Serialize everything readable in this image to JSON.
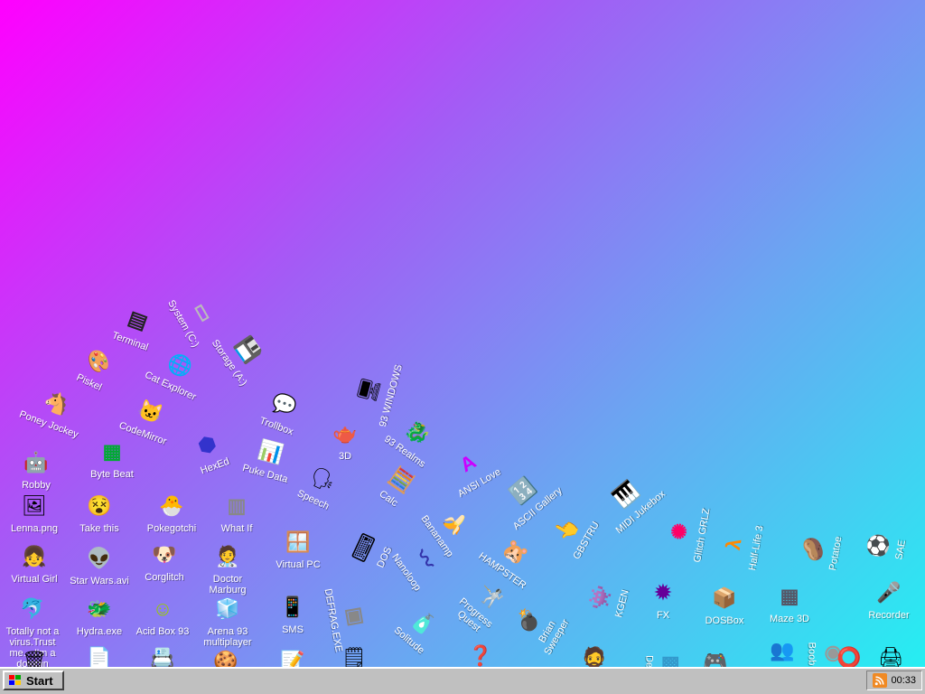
{
  "desktop": {
    "icons": [
      {
        "label": "Terminal",
        "icon": "terminal-icon",
        "glyph": "▤",
        "color": "#222"
      },
      {
        "label": "System (C:)",
        "icon": "drive-icon",
        "glyph": "▭",
        "color": "#bbb"
      },
      {
        "label": "Piskel",
        "icon": "palette-icon",
        "glyph": "🎨",
        "color": ""
      },
      {
        "label": "Cat Explorer",
        "icon": "globe-icon",
        "glyph": "🌐",
        "color": ""
      },
      {
        "label": "Storage (A:)",
        "icon": "floppy-icon",
        "glyph": "💾",
        "color": ""
      },
      {
        "label": "Poney Jockey",
        "icon": "pony-icon",
        "glyph": "🐴",
        "color": ""
      },
      {
        "label": "CodeMirror",
        "icon": "cat-icon",
        "glyph": "🐱",
        "color": ""
      },
      {
        "label": "Trollbox",
        "icon": "chat-icon",
        "glyph": "💬",
        "color": ""
      },
      {
        "label": "93 WINDOWS",
        "icon": "computer-icon",
        "glyph": "🖥",
        "color": ""
      },
      {
        "label": "Robby",
        "icon": "robot-icon",
        "glyph": "🤖",
        "color": ""
      },
      {
        "label": "Byte Beat",
        "icon": "wave-icon",
        "glyph": "▦",
        "color": "#0a3"
      },
      {
        "label": "HexEd",
        "icon": "hex-icon",
        "glyph": "⬢",
        "color": "#33c"
      },
      {
        "label": "3D",
        "icon": "teapot-icon",
        "glyph": "🫖",
        "color": ""
      },
      {
        "label": "93 Realms",
        "icon": "dragon-icon",
        "glyph": "🐉",
        "color": ""
      },
      {
        "label": "Puke Data",
        "icon": "data-icon",
        "glyph": "📊",
        "color": ""
      },
      {
        "label": "Lenna.png",
        "icon": "image-icon",
        "glyph": "🖼",
        "color": ""
      },
      {
        "label": "Take this",
        "icon": "face-icon",
        "glyph": "😵",
        "color": ""
      },
      {
        "label": "Speech",
        "icon": "speech-icon",
        "glyph": "🗣",
        "color": ""
      },
      {
        "label": "Calc",
        "icon": "calculator-icon",
        "glyph": "🧮",
        "color": ""
      },
      {
        "label": "ANSI Love",
        "icon": "ansi-icon",
        "glyph": "A",
        "color": "#c0f"
      },
      {
        "label": "ASCII Gallery",
        "icon": "ascii-icon",
        "glyph": "🔢",
        "color": ""
      },
      {
        "label": "MIDI Jukebox",
        "icon": "midi-icon",
        "glyph": "🎹",
        "color": ""
      },
      {
        "label": "Pokegotchi",
        "icon": "pokegotchi-icon",
        "glyph": "🐣",
        "color": ""
      },
      {
        "label": "What If",
        "icon": "whatif-icon",
        "glyph": "▥",
        "color": "#888"
      },
      {
        "label": "Virtual PC",
        "icon": "window-icon",
        "glyph": "🪟",
        "color": ""
      },
      {
        "label": "DOS",
        "icon": "dos-icon",
        "glyph": "⌨",
        "color": ""
      },
      {
        "label": "Bananamp",
        "icon": "banana-icon",
        "glyph": "🍌",
        "color": ""
      },
      {
        "label": "HAMPSTER",
        "icon": "hamster-icon",
        "glyph": "🐹",
        "color": ""
      },
      {
        "label": "GBSTRU",
        "icon": "cursor-icon",
        "glyph": "👆",
        "color": ""
      },
      {
        "label": "Glitch GRLZ",
        "icon": "glitch-icon",
        "glyph": "✺",
        "color": "#f06"
      },
      {
        "label": "Half-Life 3",
        "icon": "lambda-icon",
        "glyph": "λ",
        "color": "#f80"
      },
      {
        "label": "Potatoe",
        "icon": "potato-icon",
        "glyph": "🥔",
        "color": ""
      },
      {
        "label": "SAE",
        "icon": "ball-icon",
        "glyph": "⚽",
        "color": ""
      },
      {
        "label": "Virtual Girl",
        "icon": "girl-icon",
        "glyph": "👧",
        "color": ""
      },
      {
        "label": "Star Wars.avi",
        "icon": "yoda-icon",
        "glyph": "👽",
        "color": ""
      },
      {
        "label": "Corglitch",
        "icon": "dog-icon",
        "glyph": "🐶",
        "color": ""
      },
      {
        "label": "Doctor Marburg",
        "icon": "doctor-icon",
        "glyph": "🧑‍⚕",
        "color": ""
      },
      {
        "label": "DEFRAG.EXE",
        "icon": "defrag-icon",
        "glyph": "▣",
        "color": "#888"
      },
      {
        "label": "Nanoloop",
        "icon": "loop-icon",
        "glyph": "〰",
        "color": "#33a"
      },
      {
        "label": "Progress Quest",
        "icon": "quest-icon",
        "glyph": "🤺",
        "color": ""
      },
      {
        "label": "Brian Sweeper",
        "icon": "mine-icon",
        "glyph": "💣",
        "color": ""
      },
      {
        "label": "KGEN",
        "icon": "kgen-icon",
        "glyph": "👾",
        "color": ""
      },
      {
        "label": "FX",
        "icon": "fx-icon",
        "glyph": "✹",
        "color": "#609"
      },
      {
        "label": "DOSBox",
        "icon": "dosbox-icon",
        "glyph": "📦",
        "color": ""
      },
      {
        "label": "Maze 3D",
        "icon": "maze-icon",
        "glyph": "▦",
        "color": "#556"
      },
      {
        "label": "Recorder",
        "icon": "microphone-icon",
        "glyph": "🎤",
        "color": ""
      },
      {
        "label": "Totally not a virus.Trust me... I'm a dolphin",
        "icon": "dolphin-icon",
        "glyph": "🐬",
        "color": ""
      },
      {
        "label": "Hydra.exe",
        "icon": "hydra-icon",
        "glyph": "🐲",
        "color": ""
      },
      {
        "label": "Acid Box 93",
        "icon": "smiley-icon",
        "glyph": "☺",
        "color": "#9c0"
      },
      {
        "label": "Arena 93 multiplayer",
        "icon": "cube-icon",
        "glyph": "🧊",
        "color": ""
      },
      {
        "label": "SMS",
        "icon": "phone-icon",
        "glyph": "📱",
        "color": ""
      },
      {
        "label": "Solitude",
        "icon": "bottle-icon",
        "glyph": "🧴",
        "color": ""
      },
      {
        "label": "",
        "icon": "trash-icon",
        "glyph": "🗑",
        "color": ""
      },
      {
        "label": "",
        "icon": "document-icon",
        "glyph": "📄",
        "color": ""
      },
      {
        "label": "",
        "icon": "contacts-icon",
        "glyph": "📇",
        "color": ""
      },
      {
        "label": "",
        "icon": "cookie-icon",
        "glyph": "🍪",
        "color": ""
      },
      {
        "label": "",
        "icon": "write-icon",
        "glyph": "📝",
        "color": ""
      },
      {
        "label": "",
        "icon": "notepad-icon",
        "glyph": "🗒",
        "color": ""
      },
      {
        "label": "",
        "icon": "question-icon",
        "glyph": "❓",
        "color": ""
      },
      {
        "label": "",
        "icon": "duke-icon",
        "glyph": "🧔",
        "color": ""
      },
      {
        "label": "Defr",
        "icon": "defr-icon",
        "glyph": "▩",
        "color": "#39c"
      },
      {
        "label": "",
        "icon": "gameboy-icon",
        "glyph": "🎮",
        "color": ""
      },
      {
        "label": "",
        "icon": "people-icon",
        "glyph": "👥",
        "color": ""
      },
      {
        "label": "Boob",
        "icon": "boob-icon",
        "glyph": "◉",
        "color": "#999"
      },
      {
        "label": "",
        "icon": "ring-icon",
        "glyph": "⭕",
        "color": ""
      },
      {
        "label": "",
        "icon": "printer-icon",
        "glyph": "🖨",
        "color": ""
      }
    ]
  },
  "taskbar": {
    "start_label": "Start",
    "clock": "00:33",
    "tray_icon": "rss-icon"
  }
}
